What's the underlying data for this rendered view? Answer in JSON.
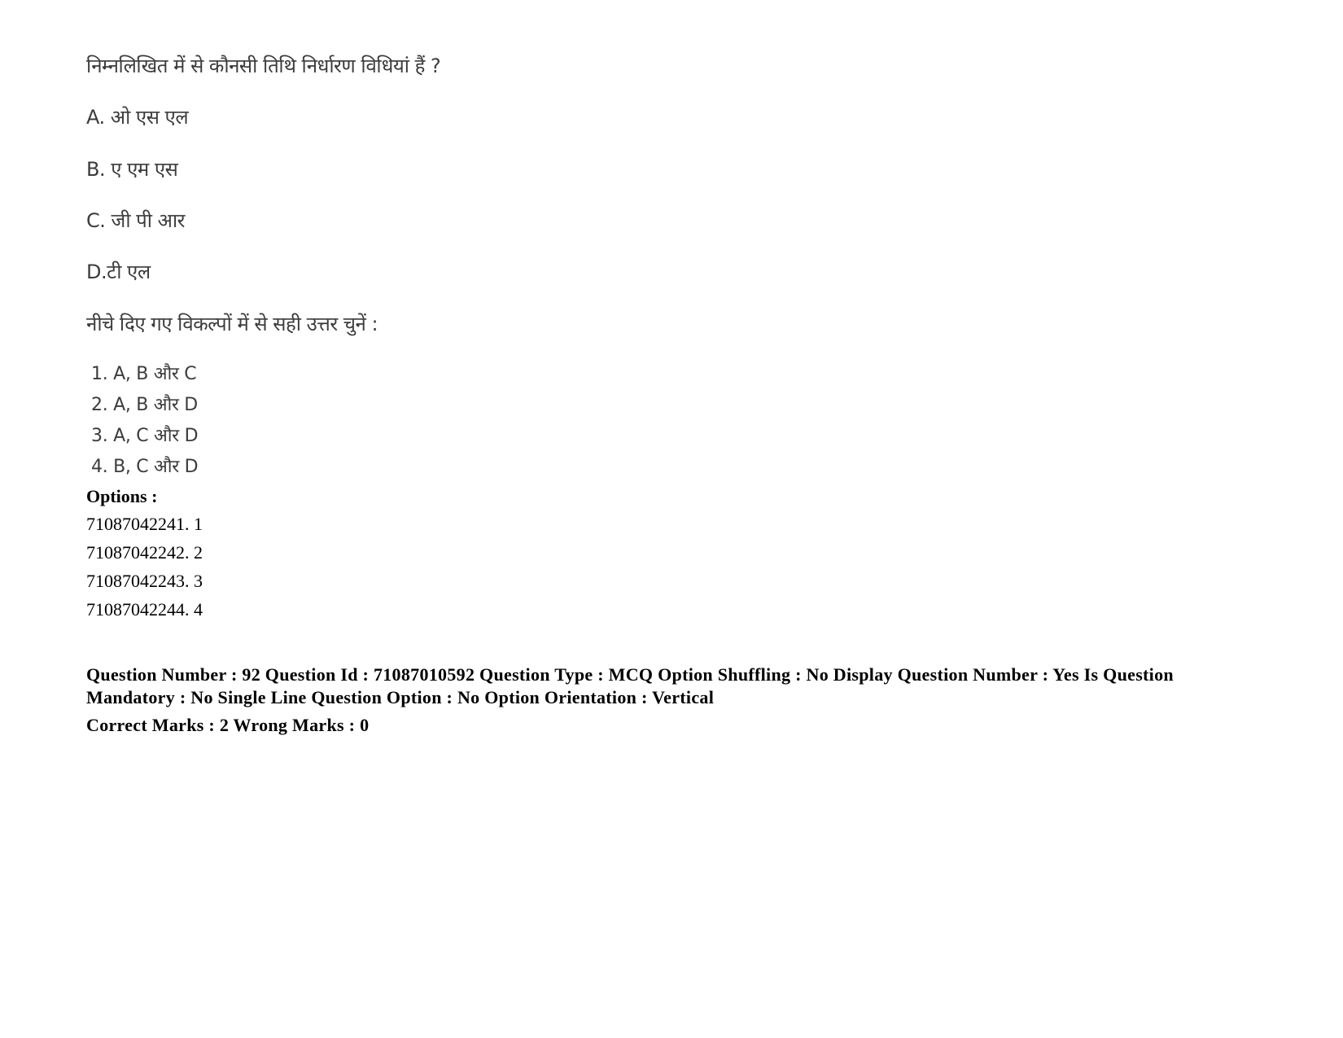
{
  "question": {
    "stem": "निम्नलिखित में से कौनसी तिथि निर्धारण विधियां हैं ?",
    "statements": [
      {
        "label": "A. ओ एस एल"
      },
      {
        "label": "B. ए एम एस"
      },
      {
        "label": "C. जी पी आर"
      },
      {
        "label": "D.टी एल"
      }
    ],
    "instruction": "नीचे दिए गए विकल्पों में से सही उत्तर चुनें :",
    "choices": [
      "1. A, B और C",
      "2. A, B और D",
      "3. A, C और D",
      "4. B, C और D"
    ]
  },
  "options": {
    "heading": "Options :",
    "items": [
      "71087042241. 1",
      "71087042242. 2",
      "71087042243. 3",
      "71087042244. 4"
    ]
  },
  "metadata": {
    "line1": "Question Number : 92 Question Id : 71087010592 Question Type : MCQ Option Shuffling : No Display Question Number : Yes Is Question Mandatory : No Single Line Question Option : No Option Orientation : Vertical",
    "marks": "Correct Marks : 2 Wrong Marks : 0"
  }
}
